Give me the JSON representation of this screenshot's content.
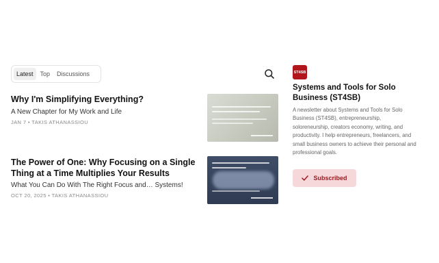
{
  "tabs": [
    {
      "label": "Latest",
      "active": true
    },
    {
      "label": "Top",
      "active": false
    },
    {
      "label": "Discussions",
      "active": false
    }
  ],
  "search": {
    "icon": "search-icon"
  },
  "posts": [
    {
      "title": "Why I'm Simplifying Everything?",
      "subtitle": "A New Chapter for My Work and Life",
      "meta": "JAN 7 • TAKIS ATHANASSIOU",
      "thumbnail": "post-thumbnail"
    },
    {
      "title": "The Power of One: Why Focusing on a Single Thing at a Time Multiplies Your Results",
      "subtitle": "What You Can Do With The Right Focus and… Systems!",
      "meta": "OCT 20, 2025 • TAKIS ATHANASSIOU",
      "thumbnail": "post-thumbnail"
    }
  ],
  "publication": {
    "logo_text": "ST4SB",
    "logo_color": "#b3151c",
    "title": "Systems and Tools for Solo Business (ST4SB)",
    "description": "A newsletter about Systems and Tools for Solo Business (ST4SB), entrepreneurship, soloreneurship, creators economy, writing, and productivity. I help entrepreneurs, freelancers, and small business owners to achieve their personal and professional goals.",
    "subscribe_label": "Subscribed",
    "subscribe_icon": "check-icon",
    "subscribe_bg": "#f7d8da",
    "subscribe_color": "#9b1b22"
  }
}
